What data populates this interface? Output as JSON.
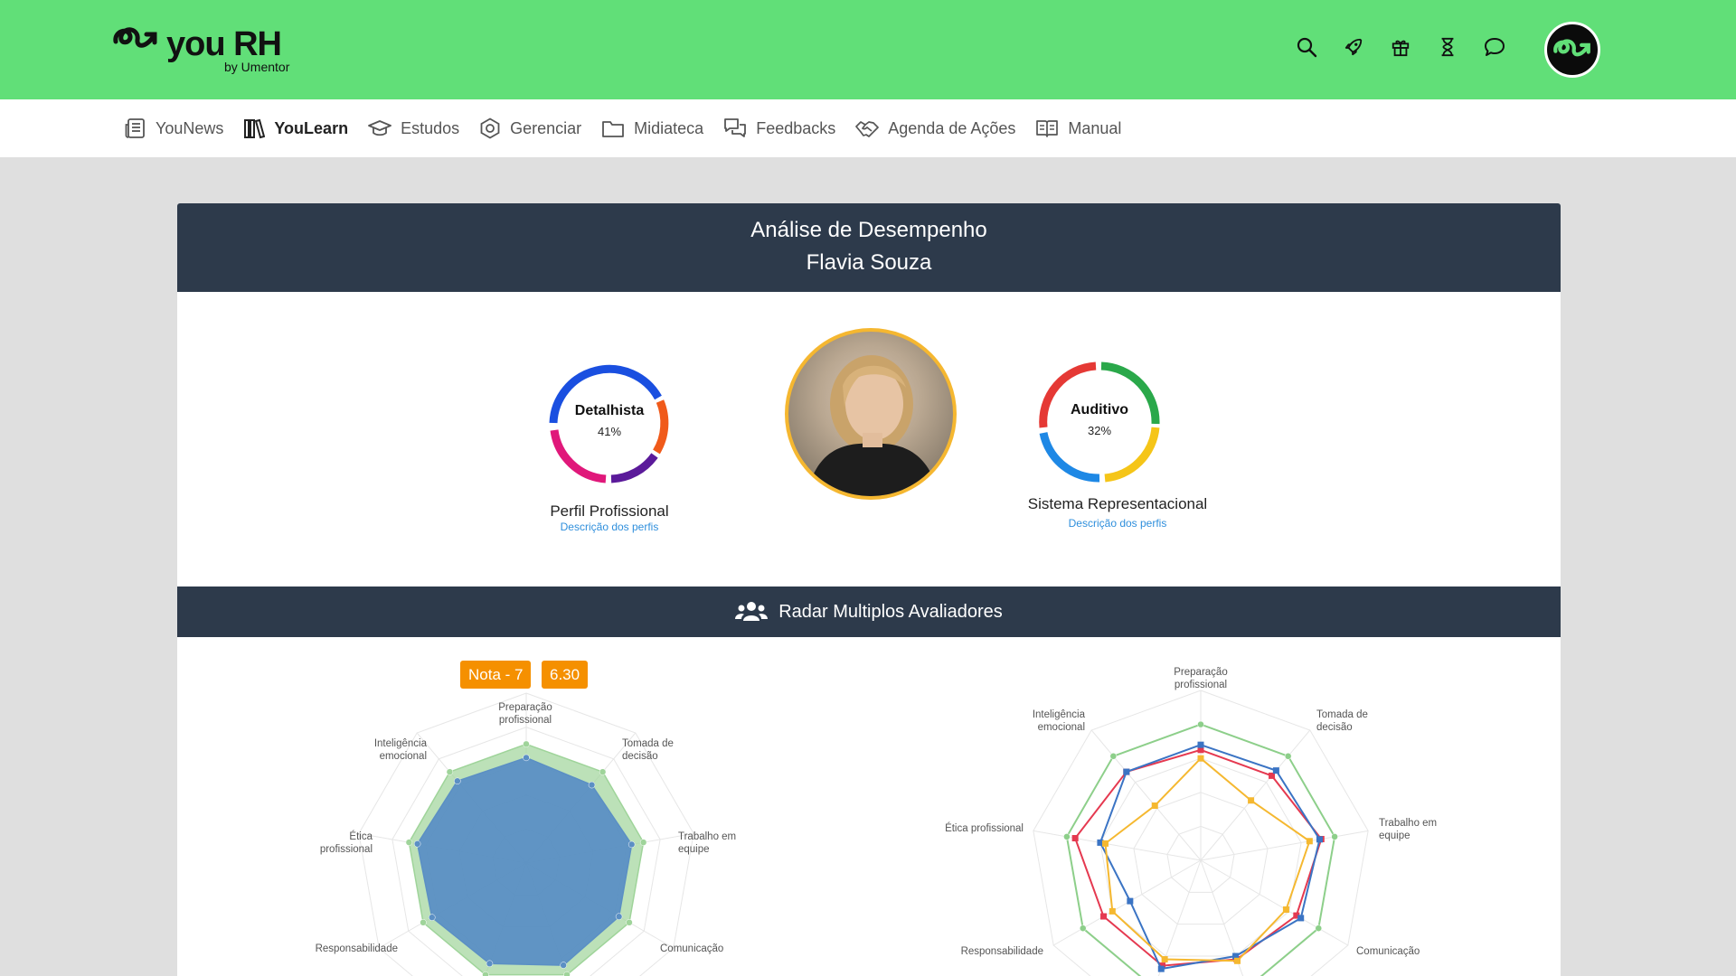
{
  "brand": {
    "name": "you RH",
    "by": "by Umentor"
  },
  "top_icons": [
    "search-icon",
    "rocket-icon",
    "gift-icon",
    "hourglass-icon",
    "chat-icon"
  ],
  "nav": [
    {
      "label": "YouNews",
      "icon": "newspaper-icon"
    },
    {
      "label": "YouLearn",
      "icon": "books-icon",
      "active": true
    },
    {
      "label": "Estudos",
      "icon": "graduation-cap-icon"
    },
    {
      "label": "Gerenciar",
      "icon": "hexagon-gear-icon"
    },
    {
      "label": "Midiateca",
      "icon": "folder-icon"
    },
    {
      "label": "Feedbacks",
      "icon": "feedback-icon"
    },
    {
      "label": "Agenda de Ações",
      "icon": "handshake-icon"
    },
    {
      "label": "Manual",
      "icon": "book-open-icon"
    }
  ],
  "header": {
    "title": "Análise de Desempenho",
    "name": "Flavia Souza"
  },
  "profile": {
    "label": "Detalhista",
    "percent": "41%",
    "caption": "Perfil Profissional",
    "link": "Descrição dos perfis",
    "colors": [
      "#1a4fe0",
      "#f05a1a",
      "#5b1a9a",
      "#e0187a"
    ]
  },
  "representational": {
    "label": "Auditivo",
    "percent": "32%",
    "caption": "Sistema Representacional",
    "link": "Descrição dos perfis",
    "colors": [
      "#e53935",
      "#2aa84a",
      "#f5c518",
      "#1e88e5"
    ]
  },
  "radar_section": {
    "title": "Radar Multiplos Avaliadores"
  },
  "badges": {
    "nota": "Nota - 7",
    "score": "6.30"
  },
  "radar_labels_left": {
    "preparacao": "Preparação profissional",
    "tomada": "Tomada de decisão",
    "trabalho": "Trabalho em equipe",
    "comunicacao": "Comunicação",
    "responsabilidade": "Responsabilidade",
    "etica": "Ética profissional",
    "inteligencia": "Inteligência emocional"
  },
  "radar_labels_right": {
    "preparacao": "Preparação profissional",
    "tomada": "Tomada de decisão",
    "trabalho": "Trabalho em equipe",
    "comunicacao": "Comunicação",
    "responsabilidade": "Responsabilidade",
    "etica": "Ética profissional",
    "inteligencia": "Inteligência emocional"
  },
  "chart_data": [
    {
      "type": "radar",
      "categories": [
        "Preparação profissional",
        "Tomada de decisão",
        "Trabalho em equipe",
        "Comunicação",
        "",
        "",
        "Responsabilidade",
        "Ética profissional",
        "Inteligência emocional"
      ],
      "max": 10,
      "series": [
        {
          "values": [
            7,
            7,
            7,
            7,
            7,
            7,
            7,
            7,
            7
          ],
          "color": "#9fd49a"
        },
        {
          "values": [
            6.2,
            6,
            6.3,
            6.3,
            6.4,
            6.3,
            6.4,
            6.5,
            6.3
          ],
          "color": "#5b8fc4"
        }
      ]
    },
    {
      "type": "radar",
      "categories": [
        "Preparação profissional",
        "Tomada de decisão",
        "Trabalho em equipe",
        "Comunicação",
        "",
        "",
        "Responsabilidade",
        "Ética profissional",
        "Inteligência emocional"
      ],
      "max": 10,
      "series": [
        {
          "values": [
            8,
            8,
            8,
            8,
            8,
            8,
            8,
            8,
            8
          ],
          "color": "#8dcf8a"
        },
        {
          "values": [
            6.5,
            6.5,
            7.2,
            6.5,
            6.2,
            6.6,
            6.6,
            7.5,
            6.8
          ],
          "color": "#e53950"
        },
        {
          "values": [
            6.8,
            6.9,
            7.1,
            6.8,
            6.0,
            6.8,
            4.8,
            6.0,
            6.8
          ],
          "color": "#3b74c4"
        },
        {
          "values": [
            6.0,
            4.6,
            6.5,
            5.8,
            6.3,
            6.2,
            6.0,
            5.7,
            4.2
          ],
          "color": "#f5b830"
        }
      ]
    }
  ]
}
